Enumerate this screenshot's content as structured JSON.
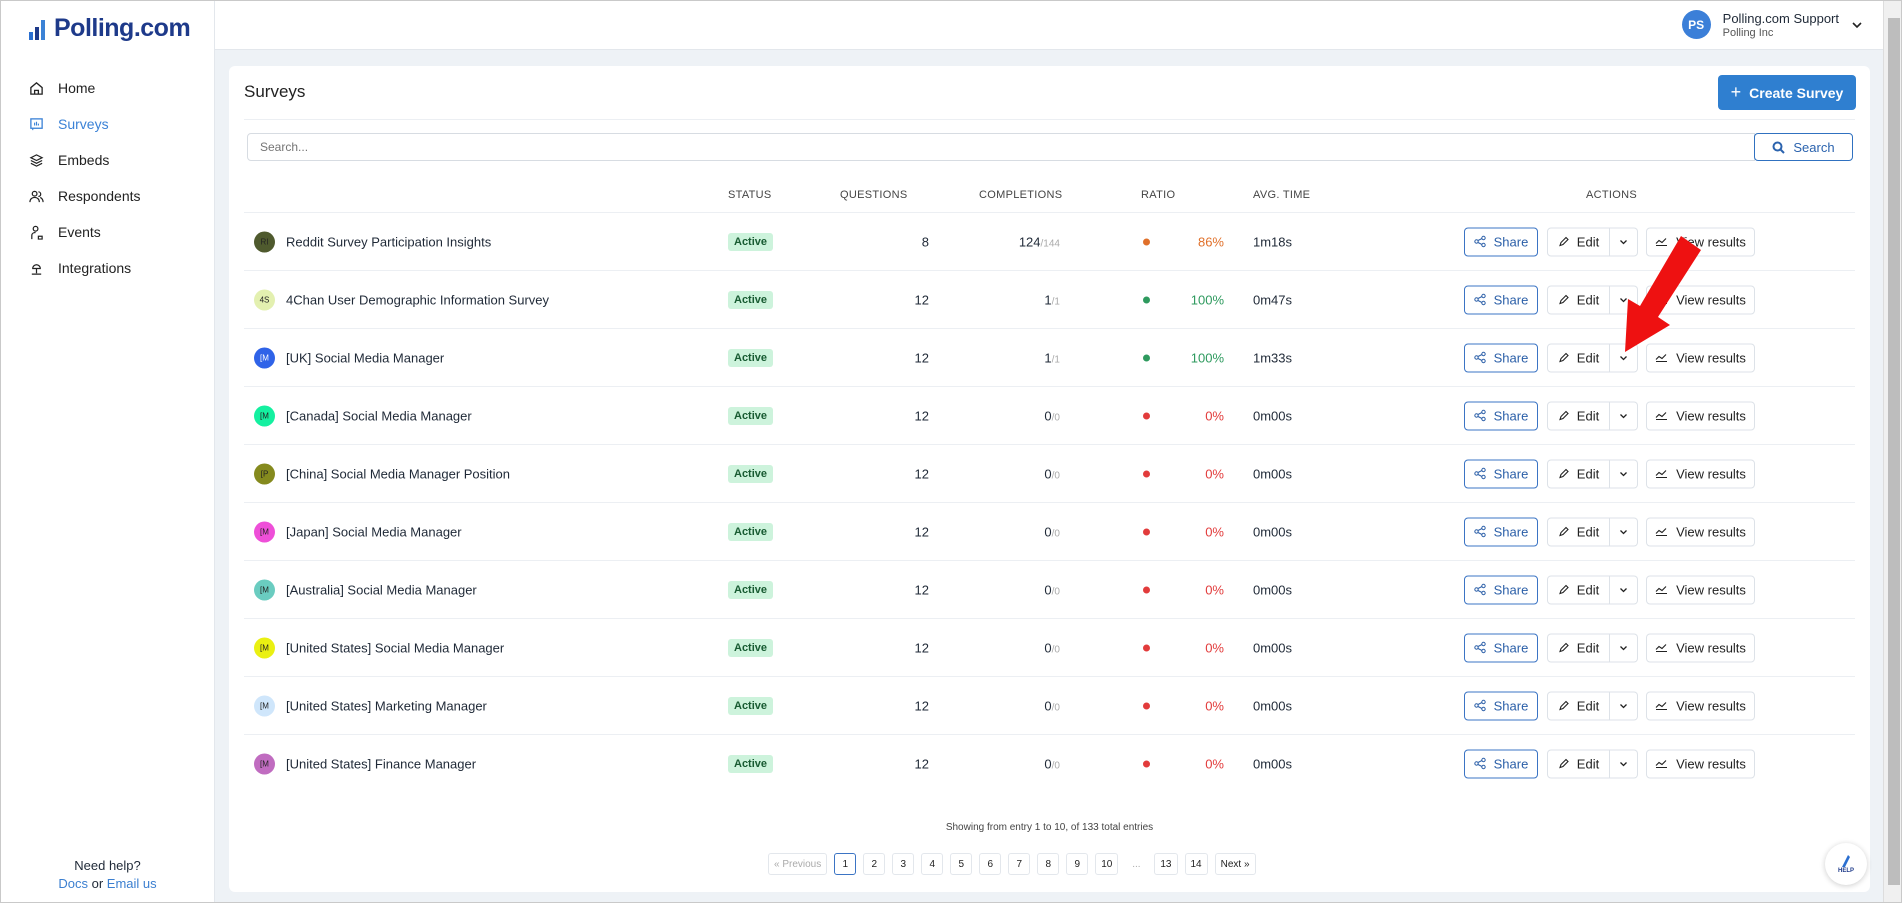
{
  "brand": {
    "name": "Polling.com"
  },
  "sidebar": {
    "items": [
      {
        "label": "Home",
        "icon": "home-icon",
        "active": false
      },
      {
        "label": "Surveys",
        "icon": "surveys-icon",
        "active": true
      },
      {
        "label": "Embeds",
        "icon": "layers-icon",
        "active": false
      },
      {
        "label": "Respondents",
        "icon": "users-icon",
        "active": false
      },
      {
        "label": "Events",
        "icon": "events-icon",
        "active": false
      },
      {
        "label": "Integrations",
        "icon": "integrations-icon",
        "active": false
      }
    ],
    "help": {
      "title": "Need help?",
      "docs": "Docs",
      "or": "or",
      "email": "Email us"
    }
  },
  "user": {
    "initials": "PS",
    "name": "Polling.com Support",
    "org": "Polling Inc"
  },
  "page": {
    "title": "Surveys",
    "create_label": "Create Survey",
    "search_placeholder": "Search...",
    "search_label": "Search"
  },
  "columns": {
    "status": "STATUS",
    "questions": "QUESTIONS",
    "completions": "COMPLETIONS",
    "ratio": "RATIO",
    "avg_time": "AVG. TIME",
    "actions": "ACTIONS"
  },
  "actions": {
    "share": "Share",
    "edit": "Edit",
    "view": "View results"
  },
  "colors": {
    "accent": "#2f7fd0",
    "ratio_high": "#2e9a5e",
    "ratio_mid": "#e0702a",
    "ratio_zero": "#e23b3b"
  },
  "surveys": [
    {
      "initials": "RI",
      "avatar_color": "#4f5a2e",
      "name": "Reddit Survey Participation Insights",
      "status": "Active",
      "questions": "8",
      "completed": "124",
      "total": "/144",
      "ratio": "86%",
      "ratio_color": "#e0702a",
      "avg_time": "1m18s"
    },
    {
      "initials": "4S",
      "avatar_color": "#e3f0b0",
      "name": "4Chan User Demographic Information Survey",
      "status": "Active",
      "questions": "12",
      "completed": "1",
      "total": "/1",
      "ratio": "100%",
      "ratio_color": "#2e9a5e",
      "avg_time": "0m47s"
    },
    {
      "initials": "[M",
      "avatar_color": "#2f63e8",
      "name": "[UK] Social Media Manager",
      "status": "Active",
      "questions": "12",
      "completed": "1",
      "total": "/1",
      "ratio": "100%",
      "ratio_color": "#2e9a5e",
      "avg_time": "1m33s"
    },
    {
      "initials": "[M",
      "avatar_color": "#14f0a0",
      "name": "[Canada] Social Media Manager",
      "status": "Active",
      "questions": "12",
      "completed": "0",
      "total": "/0",
      "ratio": "0%",
      "ratio_color": "#e23b3b",
      "avg_time": "0m00s"
    },
    {
      "initials": "[P",
      "avatar_color": "#858a1e",
      "name": "[China] Social Media Manager Position",
      "status": "Active",
      "questions": "12",
      "completed": "0",
      "total": "/0",
      "ratio": "0%",
      "ratio_color": "#e23b3b",
      "avg_time": "0m00s"
    },
    {
      "initials": "[M",
      "avatar_color": "#ee4fd8",
      "name": "[Japan] Social Media Manager",
      "status": "Active",
      "questions": "12",
      "completed": "0",
      "total": "/0",
      "ratio": "0%",
      "ratio_color": "#e23b3b",
      "avg_time": "0m00s"
    },
    {
      "initials": "[M",
      "avatar_color": "#6accc0",
      "name": "[Australia] Social Media Manager",
      "status": "Active",
      "questions": "12",
      "completed": "0",
      "total": "/0",
      "ratio": "0%",
      "ratio_color": "#e23b3b",
      "avg_time": "0m00s"
    },
    {
      "initials": "[M",
      "avatar_color": "#eaf012",
      "name": "[United States] Social Media Manager",
      "status": "Active",
      "questions": "12",
      "completed": "0",
      "total": "/0",
      "ratio": "0%",
      "ratio_color": "#e23b3b",
      "avg_time": "0m00s"
    },
    {
      "initials": "[M",
      "avatar_color": "#cfe6fb",
      "name": "[United States] Marketing Manager",
      "status": "Active",
      "questions": "12",
      "completed": "0",
      "total": "/0",
      "ratio": "0%",
      "ratio_color": "#e23b3b",
      "avg_time": "0m00s"
    },
    {
      "initials": "[M",
      "avatar_color": "#c06cc0",
      "name": "[United States] Finance Manager",
      "status": "Active",
      "questions": "12",
      "completed": "0",
      "total": "/0",
      "ratio": "0%",
      "ratio_color": "#e23b3b",
      "avg_time": "0m00s"
    }
  ],
  "pagination": {
    "summary": "Showing from entry 1 to 10, of 133 total entries",
    "previous": "« Previous",
    "next": "Next »",
    "pages": [
      "1",
      "2",
      "3",
      "4",
      "5",
      "6",
      "7",
      "8",
      "9",
      "10",
      "...",
      "13",
      "14"
    ],
    "current": "1"
  },
  "help_bubble": {
    "label": "HELP"
  }
}
